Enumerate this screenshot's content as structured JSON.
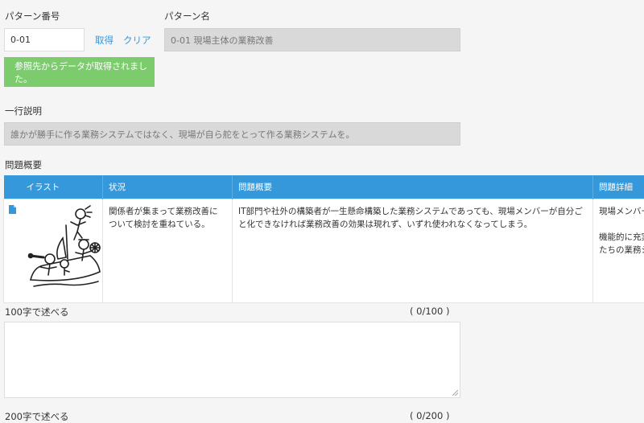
{
  "pattern_number": {
    "label": "パターン番号",
    "value": "0-01"
  },
  "actions": {
    "fetch": "取得",
    "clear": "クリア"
  },
  "notice": {
    "line1": "参照先からデータが取得されまし",
    "line2": "た。"
  },
  "pattern_name": {
    "label": "パターン名",
    "value": "0-01 現場主体の業務改善"
  },
  "one_line": {
    "label": "一行説明",
    "value": "誰かが勝手に作る業務システムではなく、現場が自ら舵をとって作る業務システムを。"
  },
  "issue_overview": {
    "label": "問題概要",
    "columns": [
      "イラスト",
      "状況",
      "問題概要",
      "問題詳細"
    ],
    "row": {
      "situation": "関係者が集まって業務改善について検討を重ねている。",
      "summary": "IT部門や社外の構築者が一生懸命構築した業務システムであっても、現場メンバーが自分ごと化できなければ業務改善の効果は現れず、いずれ使われなくなってしまう。",
      "detail_line1": "現場メンバー",
      "detail_line2": "機能的に充実",
      "detail_line3": "たちの業務シ"
    }
  },
  "field_100": {
    "label": "100字で述べる",
    "counter": "( 0/100 )"
  },
  "field_200": {
    "label": "200字で述べる",
    "counter": "( 0/200 )"
  }
}
